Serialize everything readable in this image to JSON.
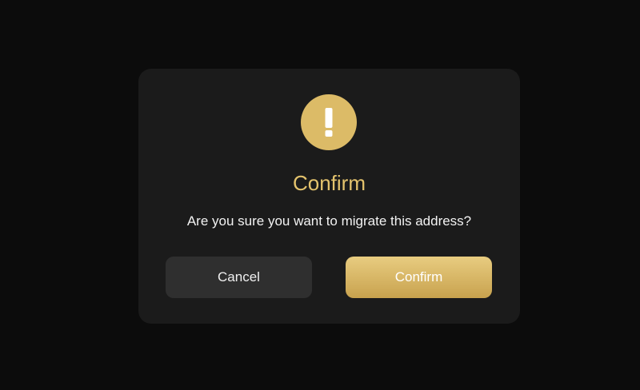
{
  "dialog": {
    "icon": "exclamation-icon",
    "title": "Confirm",
    "message": "Are you sure you want to migrate this address?",
    "cancel_label": "Cancel",
    "confirm_label": "Confirm"
  },
  "colors": {
    "backdrop": "#0c0c0c",
    "dialog_background": "#1b1b1b",
    "accent_gold": "#dcbb67",
    "cancel_button": "#2f2f2f"
  }
}
